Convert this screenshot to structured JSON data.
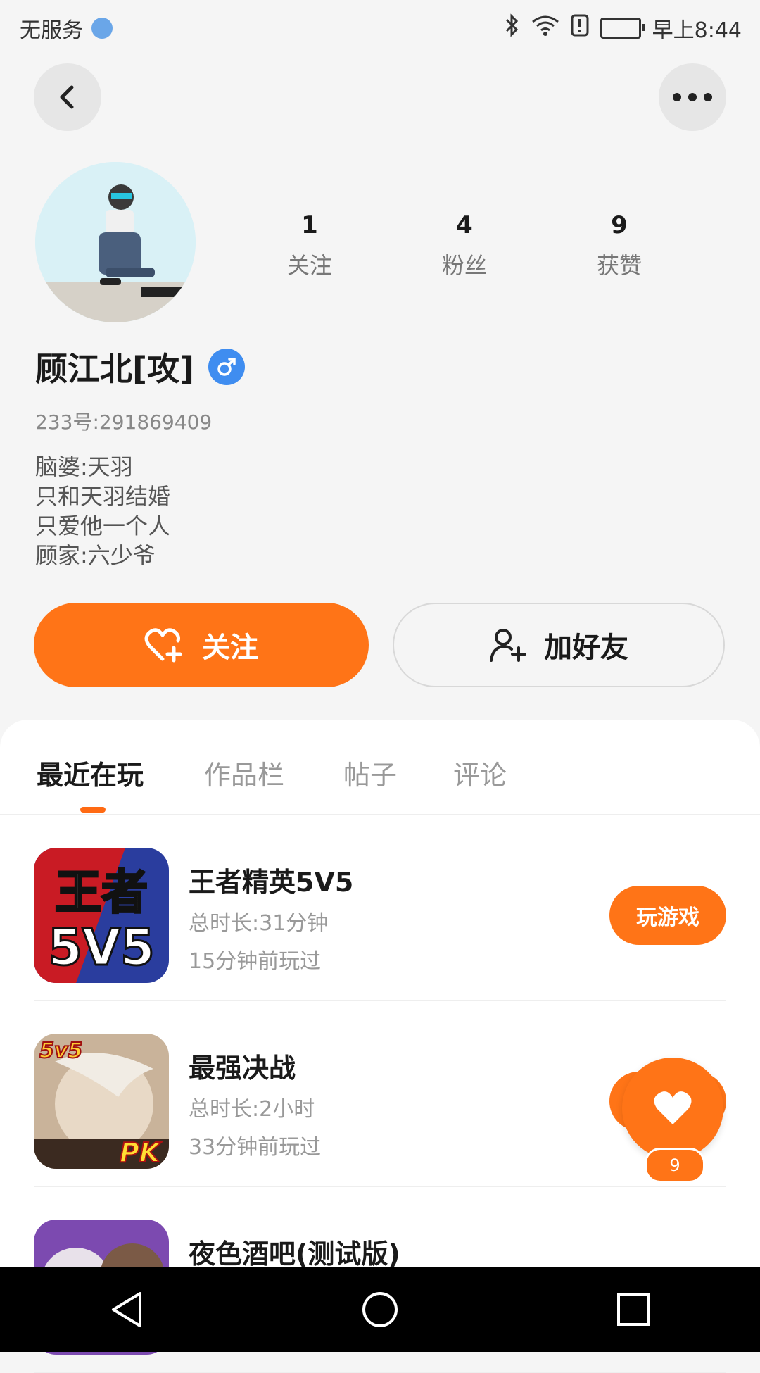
{
  "status_bar": {
    "carrier": "无服务",
    "time": "早上8:44"
  },
  "profile": {
    "stats": [
      {
        "value": "1",
        "label": "关注"
      },
      {
        "value": "4",
        "label": "粉丝"
      },
      {
        "value": "9",
        "label": "获赞"
      }
    ],
    "name": "顾江北[攻]",
    "id_text": "233号:291869409",
    "bio_lines": [
      "脑婆:天羽",
      "只和天羽结婚",
      "只爱他一个人",
      "顾家:六少爷"
    ]
  },
  "actions": {
    "follow_label": "关注",
    "add_friend_label": "加好友"
  },
  "tabs": [
    {
      "label": "最近在玩",
      "active": true
    },
    {
      "label": "作品栏",
      "active": false
    },
    {
      "label": "帖子",
      "active": false
    },
    {
      "label": "评论",
      "active": false
    }
  ],
  "games": [
    {
      "title": "王者精英5V5",
      "duration": "总时长:31分钟",
      "last_played": "15分钟前玩过",
      "button": "玩游戏",
      "icon_text_top": "王者",
      "icon_text_bottom": "5V5"
    },
    {
      "title": "最强决战",
      "duration": "总时长:2小时",
      "last_played": "33分钟前玩过",
      "icon_badge": "5v5",
      "icon_badge2": "PK"
    },
    {
      "title": "夜色酒吧(测试版)"
    }
  ],
  "floating_like": {
    "count": "9"
  },
  "colors": {
    "accent": "#ff7417",
    "gender": "#3f8df0"
  }
}
